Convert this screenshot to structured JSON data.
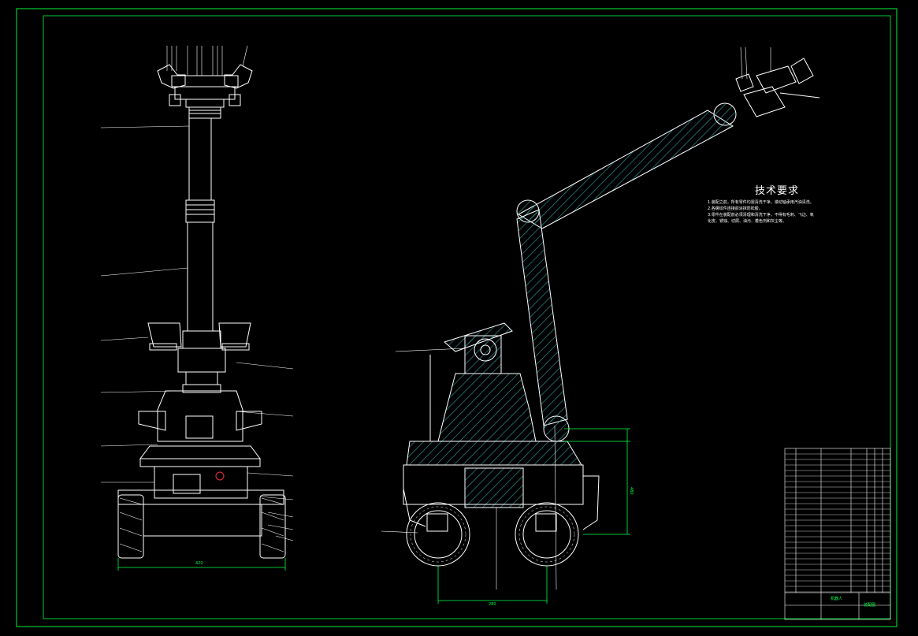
{
  "drawing": {
    "tech_requirements_title": "技术要求",
    "tech_notes": [
      "1.装配之前，所有零件均需清洗干净，滚动轴承用汽油清洗。",
      "2.各螺纹件连接前涂抹防松胶。",
      "3.零件在装配前必须清理和清洗干净，不得有毛刺、飞边、氧",
      "  化皮、锈蚀、切屑、油污、着色剂和灰尘等。"
    ],
    "front_width_dim": "420",
    "side_wheelbase_dim": "280",
    "side_height_dim": "480",
    "title_block_name": "机器人",
    "title_block_code": "装配图"
  },
  "colors": {
    "background": "#000000",
    "border": "#00cc33",
    "line": "#ffffff",
    "hatch": "#2e8b8b",
    "dimension": "#00ff44",
    "table_text": "#00ff44"
  }
}
